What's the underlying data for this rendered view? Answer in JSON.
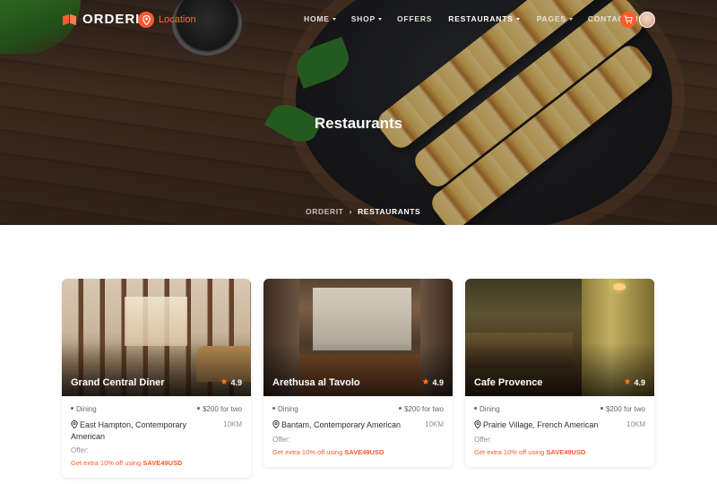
{
  "colors": {
    "accent": "#ff5a2e",
    "nav_text": "#e7e2dd",
    "hero_overlay": "rgba(10,8,6,0.28)"
  },
  "brand": {
    "logo_text": "ORDERIT",
    "location_label": "Location"
  },
  "nav": {
    "items": [
      {
        "label": "HOME",
        "has_dropdown": true,
        "active": false
      },
      {
        "label": "SHOP",
        "has_dropdown": true,
        "active": false
      },
      {
        "label": "OFFERS",
        "has_dropdown": false,
        "active": false
      },
      {
        "label": "RESTAURANTS",
        "has_dropdown": true,
        "active": true
      },
      {
        "label": "PAGES",
        "has_dropdown": true,
        "active": false
      },
      {
        "label": "CONTACT US",
        "has_dropdown": false,
        "active": false
      }
    ],
    "cart_icon": "cart-icon",
    "avatar": "user-avatar"
  },
  "hero": {
    "title": "Restaurants",
    "breadcrumb": {
      "home": "ORDERIT",
      "separator": "›",
      "current": "RESTAURANTS"
    }
  },
  "restaurants": [
    {
      "name": "Grand Central Diner",
      "rating": "4.9",
      "category": "Dining",
      "price": "$200 for two",
      "address": "East Hampton, Contemporary American",
      "distance": "10KM",
      "offer_label": "Offer:",
      "offer_prefix": "Get extra 10% off using",
      "offer_code": "SAVE49USD"
    },
    {
      "name": "Arethusa al Tavolo",
      "rating": "4.9",
      "category": "Dining",
      "price": "$200 for two",
      "address": "Bantam, Contemporary American",
      "distance": "10KM",
      "offer_label": "Offer:",
      "offer_prefix": "Get extra 10% off using",
      "offer_code": "SAVE49USD"
    },
    {
      "name": "Cafe Provence",
      "rating": "4.9",
      "category": "Dining",
      "price": "$200 for two",
      "address": "Prairie Village, French American",
      "distance": "10KM",
      "offer_label": "Offer:",
      "offer_prefix": "Get extra 10% off using",
      "offer_code": "SAVE49USD"
    }
  ]
}
